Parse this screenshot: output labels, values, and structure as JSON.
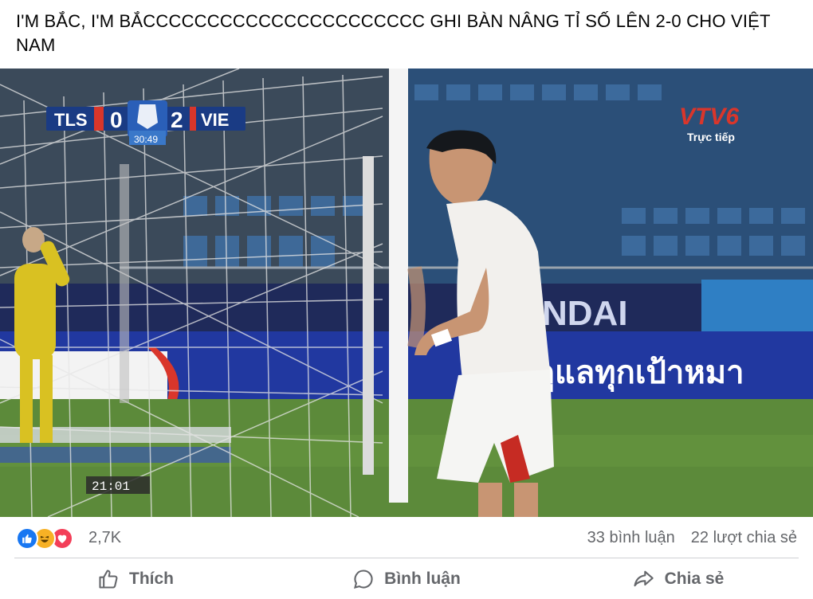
{
  "post": {
    "text": "I'M BẮC, I'M BẮCCCCCCCCCCCCCCCCCCCCCC GHI BÀN NÂNG TỈ SỐ LÊN 2-0 CHO VIỆT NAM"
  },
  "video": {
    "scoreboard": {
      "home_team": "TLS",
      "home_score": "0",
      "away_score": "2",
      "away_team": "VIE",
      "match_time": "30:49"
    },
    "channel_logo": "VTV6",
    "channel_status": "Trực tiếp",
    "replay_clock": "21:01",
    "ad_board_text_1": "NDAI",
    "ad_board_text_2": "ดูแลทุกเป้าหมา"
  },
  "stats": {
    "reaction_count": "2,7K",
    "comments": "33 bình luận",
    "shares": "22 lượt chia sẻ",
    "reaction_icons": [
      "like-icon",
      "haha-icon",
      "love-icon"
    ]
  },
  "actions": {
    "like_label": "Thích",
    "comment_label": "Bình luận",
    "share_label": "Chia sẻ"
  },
  "colors": {
    "like_blue": "#1877f2",
    "haha_yellow": "#f7b125",
    "love_red": "#f33e58",
    "secondary_text": "#65676b"
  }
}
